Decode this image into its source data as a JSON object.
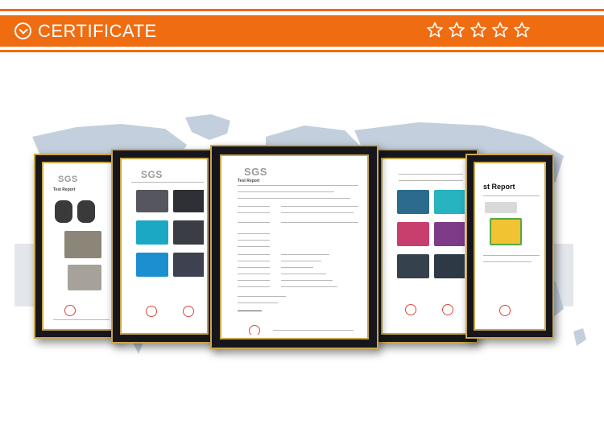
{
  "header": {
    "title": "CERTIFICATE",
    "rating_stars": 5,
    "colors": {
      "accent": "#ef6c11",
      "text": "#ffffff"
    },
    "icons": [
      "check-circle-icon",
      "star-outline-icon"
    ]
  },
  "certificates": [
    {
      "logo": "SGS",
      "heading": "Test Report"
    },
    {
      "logo": "SGS",
      "heading": ""
    },
    {
      "logo": "SGS",
      "heading": "Test Report"
    },
    {
      "logo": "",
      "heading": ""
    },
    {
      "logo": "",
      "heading": "st Report"
    }
  ]
}
